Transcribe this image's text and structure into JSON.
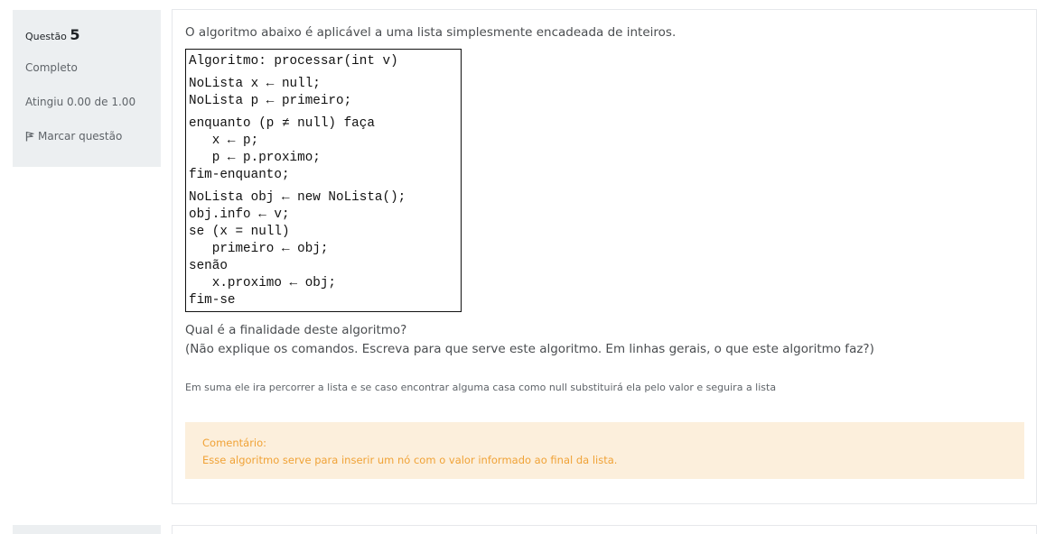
{
  "question_info": {
    "label": "Questão",
    "number": "5",
    "state": "Completo",
    "grade": "Atingiu 0.00 de 1.00",
    "flag_label": "Marcar questão",
    "flag_icon": "flag-icon"
  },
  "question": {
    "text": "O algoritmo abaixo é aplicável a uma lista simplesmente encadeada de inteiros.",
    "code_lines": [
      "Algoritmo: processar(int v)",
      "",
      "NoLista x ← null;",
      "NoLista p ← primeiro;",
      "",
      "enquanto (p ≠ null) faça",
      "   x ← p;",
      "   p ← p.proximo;",
      "fim-enquanto;",
      "",
      "NoLista obj ← new NoLista();",
      "obj.info ← v;",
      "se (x = null)",
      "   primeiro ← obj;",
      "senão",
      "   x.proximo ← obj;",
      "fim-se"
    ],
    "prompt_line1": "Qual é a finalidade deste algoritmo?",
    "prompt_line2": "(Não explique os comandos. Escreva para que serve este algoritmo. Em linhas gerais, o que este algoritmo faz?)",
    "answer": "Em suma ele ira percorrer a lista e se caso encontrar alguma casa como null substituirá ela pelo valor e seguira a lista"
  },
  "feedback": {
    "label": "Comentário:",
    "text": "Esse algoritmo serve para inserir um nó com o valor informado ao final da lista."
  },
  "colors": {
    "info_bg": "#eceff1",
    "feedback_bg": "#fcefdc",
    "feedback_text": "#f0a236"
  }
}
